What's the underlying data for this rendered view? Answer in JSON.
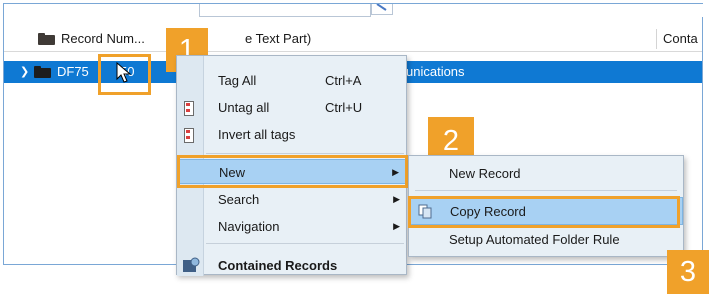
{
  "header": {
    "col_record_number": "Record Num...",
    "col_text_part": "e Text Part)",
    "col_contact": "Conta"
  },
  "record_row": {
    "record_number": "DF75",
    "record_number_suffix": "50",
    "title_fragment": "unications"
  },
  "context_menu": {
    "tag_all": "Tag All",
    "tag_all_shortcut": "Ctrl+A",
    "untag_all": "Untag all",
    "untag_all_shortcut": "Ctrl+U",
    "invert_all_tags": "Invert all tags",
    "new": "New",
    "search": "Search",
    "navigation": "Navigation",
    "contained_records": "Contained Records",
    "submenu_arrow": "▶"
  },
  "submenu": {
    "new_record": "New Record",
    "copy_record": "Copy Record",
    "setup_folder_rule": "Setup Automated Folder Rule"
  },
  "callouts": {
    "step1": "1",
    "step2": "2",
    "step3": "3"
  },
  "colors": {
    "selection": "#0f79d3",
    "menu_highlight": "#a8d1f3",
    "callout": "#f0a12a",
    "folder_icon": "#5a4a3a",
    "window_border": "#7aa7d6"
  },
  "icons": {
    "expand": "chevron-right-icon",
    "folder": "folder-icon",
    "tag": "tag-icon",
    "copy": "copy-record-icon",
    "contained": "contained-records-icon",
    "cursor": "mouse-cursor-icon"
  }
}
